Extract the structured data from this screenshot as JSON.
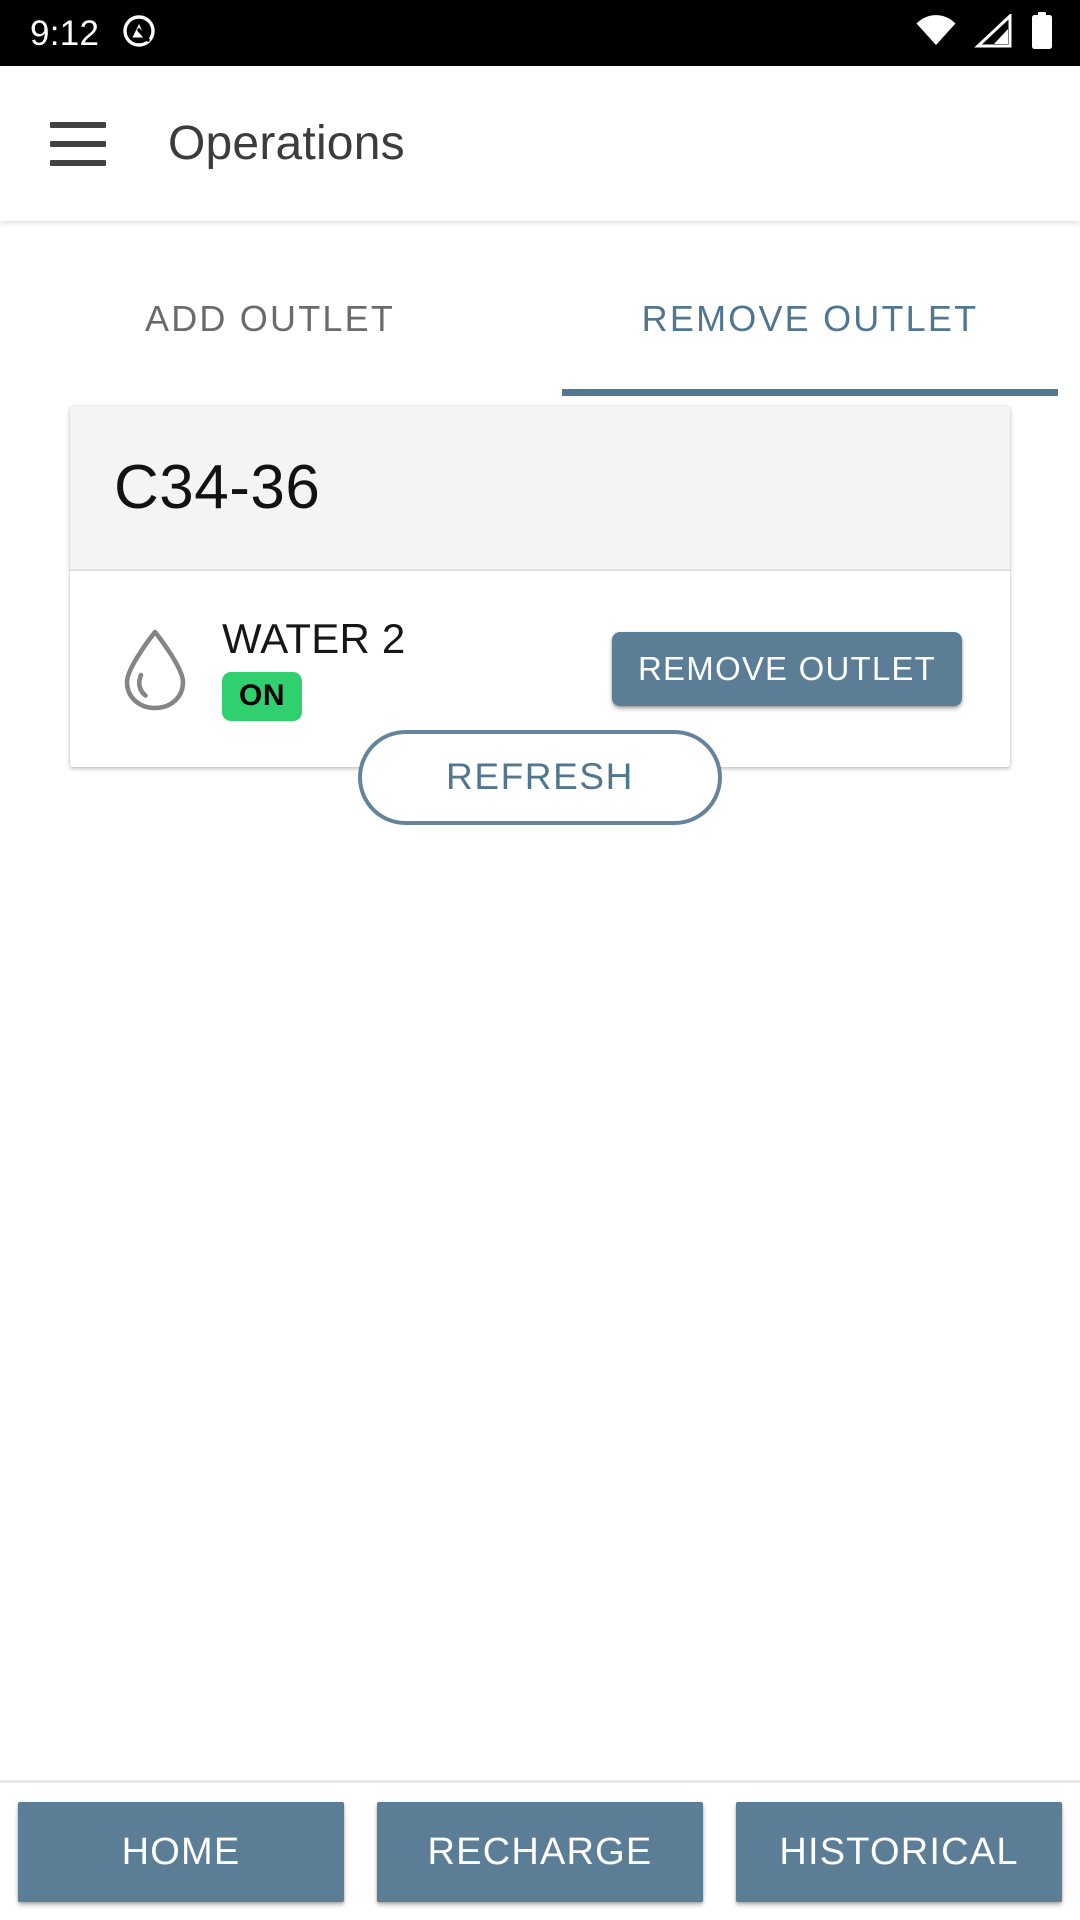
{
  "status_bar": {
    "clock": "9:12",
    "notification_icon": "quick-settings-icon",
    "wifi_icon": "wifi-icon",
    "signal_icon": "cellular-signal-icon",
    "battery_icon": "battery-full-icon",
    "background": "#000000",
    "foreground": "#ffffff"
  },
  "app_bar": {
    "menu_icon": "hamburger-menu-icon",
    "title": "Operations"
  },
  "tabs": {
    "items": [
      {
        "label": "ADD OUTLET",
        "active": false
      },
      {
        "label": "REMOVE OUTLET",
        "active": true
      }
    ],
    "active_color": "#51768f",
    "inactive_color": "#6b6b6b"
  },
  "card": {
    "header_title": "C34-36",
    "header_background": "#f4f4f4",
    "rows": [
      {
        "icon": "water-drop-icon",
        "title": "WATER 2",
        "status": "ON",
        "status_color": "#30d06f",
        "action_label": "REMOVE OUTLET"
      }
    ]
  },
  "refresh": {
    "label": "REFRESH",
    "color": "#51768f"
  },
  "bottom_nav": {
    "buttons": [
      {
        "label": "HOME"
      },
      {
        "label": "RECHARGE"
      },
      {
        "label": "HISTORICAL"
      }
    ],
    "button_color": "#5b7e96"
  }
}
